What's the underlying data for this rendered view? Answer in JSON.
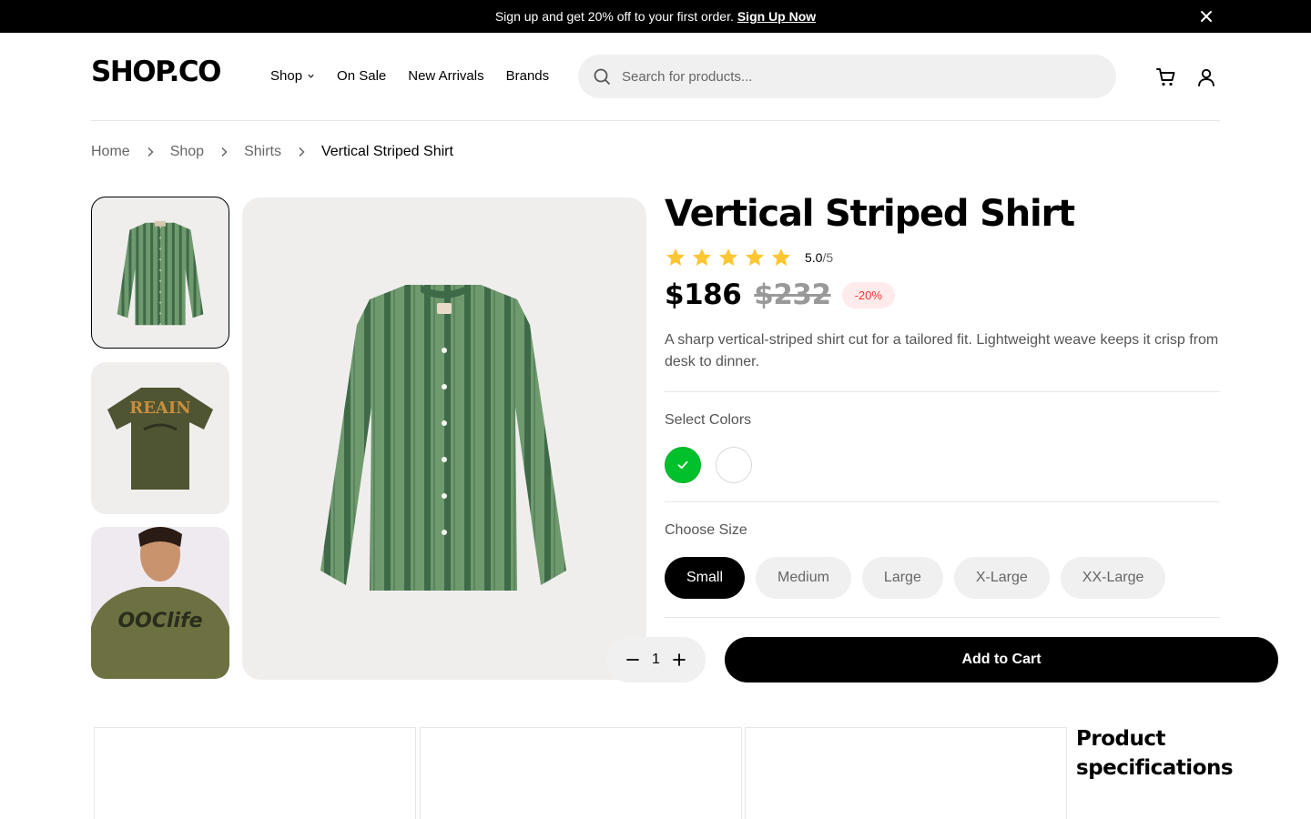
{
  "promo": {
    "message": "Sign up and get 20% off to your first order.",
    "link_label": "Sign Up Now",
    "close_icon": "close-icon"
  },
  "header": {
    "logo": "SHOP.CO",
    "nav": [
      {
        "label": "Shop",
        "has_dropdown": true
      },
      {
        "label": "On Sale"
      },
      {
        "label": "New Arrivals"
      },
      {
        "label": "Brands"
      }
    ],
    "search_placeholder": "Search for products...",
    "icons": [
      "search-icon",
      "cart-icon",
      "user-icon"
    ]
  },
  "breadcrumb": {
    "items": [
      "Home",
      "Shop",
      "Shirts"
    ],
    "current": "Vertical Striped Shirt"
  },
  "gallery": {
    "thumbnails": [
      "green striped shirt",
      "olive graphic t-shirt",
      "model in olive t-shirt"
    ],
    "active_index": 0
  },
  "product": {
    "title": "Vertical Striped Shirt",
    "rating": {
      "value": "5.0",
      "max": "/5",
      "stars": 5
    },
    "price": "$186",
    "old_price": "$232",
    "discount": "-20%",
    "description": "A sharp vertical-striped shirt cut for a tailored fit. Lightweight weave keeps it crisp from desk to dinner.",
    "colors_label": "Select Colors",
    "colors": [
      {
        "name": "green",
        "hex": "#00C12B",
        "selected": true
      },
      {
        "name": "white",
        "hex": "#FFFFFF",
        "selected": false
      }
    ],
    "size_label": "Choose Size",
    "sizes": [
      {
        "label": "Small",
        "selected": true
      },
      {
        "label": "Medium"
      },
      {
        "label": "Large"
      },
      {
        "label": "X-Large"
      },
      {
        "label": "XX-Large"
      }
    ],
    "quantity": "1",
    "add_to_cart": "Add to Cart"
  },
  "specs": {
    "title": "Product specifications"
  },
  "colors": {
    "accent": "#000000",
    "star": "#FFC633",
    "discount_text": "#FF3333",
    "discount_bg": "#FFEBEB"
  }
}
